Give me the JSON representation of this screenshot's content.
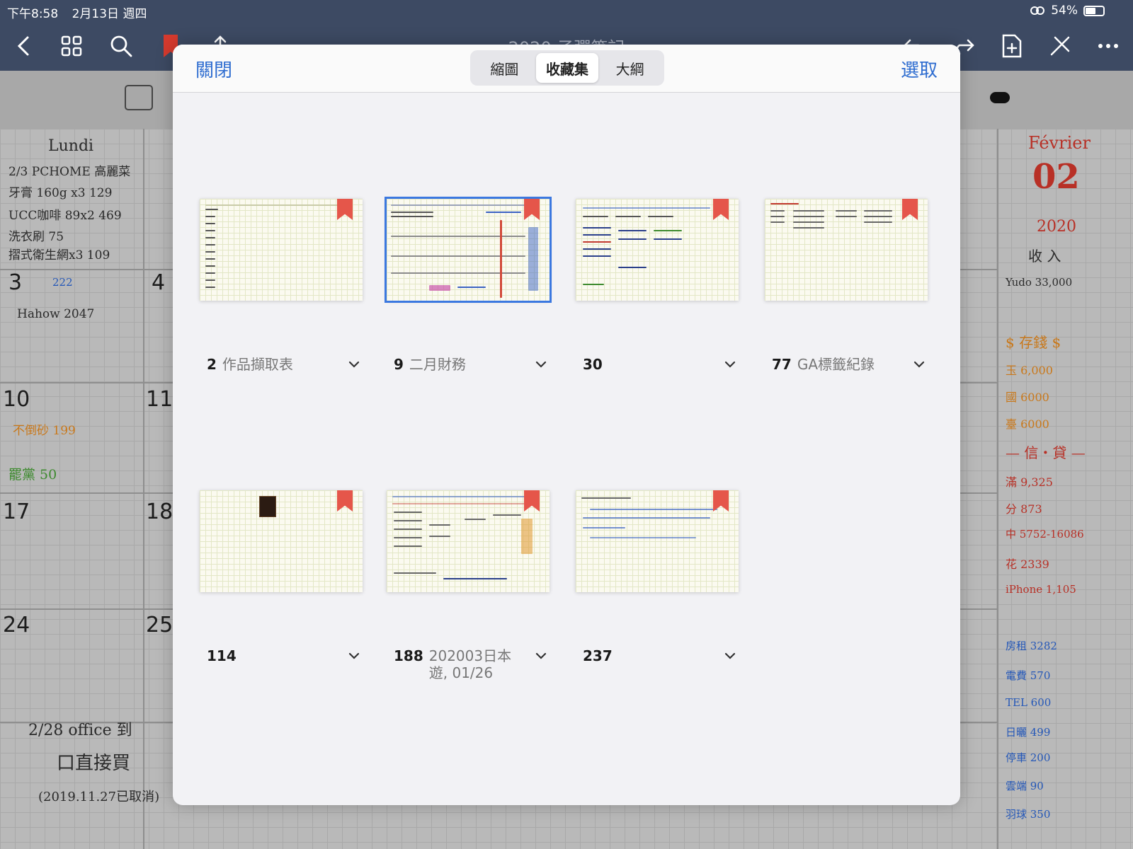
{
  "status_bar": {
    "time": "下午8:58",
    "date": "2月13日 週四",
    "battery": "54%"
  },
  "toolbar": {
    "title": "2020 子彈筆記"
  },
  "background_page": {
    "lundi_header": "Lundi",
    "month": "Février",
    "month_number": "02",
    "year": "2020",
    "days": [
      "3",
      "4",
      "10",
      "11",
      "17",
      "18",
      "24",
      "25"
    ],
    "entries": [
      "2/3 PCHOME 高麗菜",
      "牙膏 160g x3   129",
      "UCC咖啡 89x2   469",
      "洗衣刷   75",
      "摺式衛生網x3   109",
      "222",
      "Hahow 2047",
      "不倒砂 199",
      "罷黨 50",
      "2/28 office 到",
      "口直接買",
      "(2019.11.27已取消)"
    ],
    "right_notes": [
      "收 入",
      "Yudo 33,000",
      "$ 存錢 $",
      "玉 6,000",
      "國 6000",
      "臺 6000",
      "— 信・貸 —",
      "滿 9,325",
      "分 873",
      "中 5752-16086",
      "花 2339",
      "iPhone 1,105",
      "房租 3282",
      "電費 570",
      "TEL 600",
      "日曬 499",
      "停車 200",
      "雲端 90",
      "羽球 350"
    ]
  },
  "modal": {
    "close_label": "關閉",
    "select_label": "選取",
    "tabs": [
      {
        "label": "縮圖",
        "active": false
      },
      {
        "label": "收藏集",
        "active": true
      },
      {
        "label": "大綱",
        "active": false
      }
    ],
    "bookmarks": [
      {
        "page": "2",
        "title": "作品擷取表",
        "selected": false
      },
      {
        "page": "9",
        "title": "二月財務",
        "selected": true
      },
      {
        "page": "30",
        "title": "",
        "selected": false
      },
      {
        "page": "77",
        "title": "GA標籤紀錄",
        "selected": false
      },
      {
        "page": "114",
        "title": "",
        "selected": false
      },
      {
        "page": "188",
        "title": "202003日本遊, 01/26",
        "selected": false
      },
      {
        "page": "237",
        "title": "",
        "selected": false
      }
    ]
  },
  "colors": {
    "accent": "#2f6dd0",
    "bookmark": "#e5564a",
    "toolbar": "#3d4a63"
  }
}
